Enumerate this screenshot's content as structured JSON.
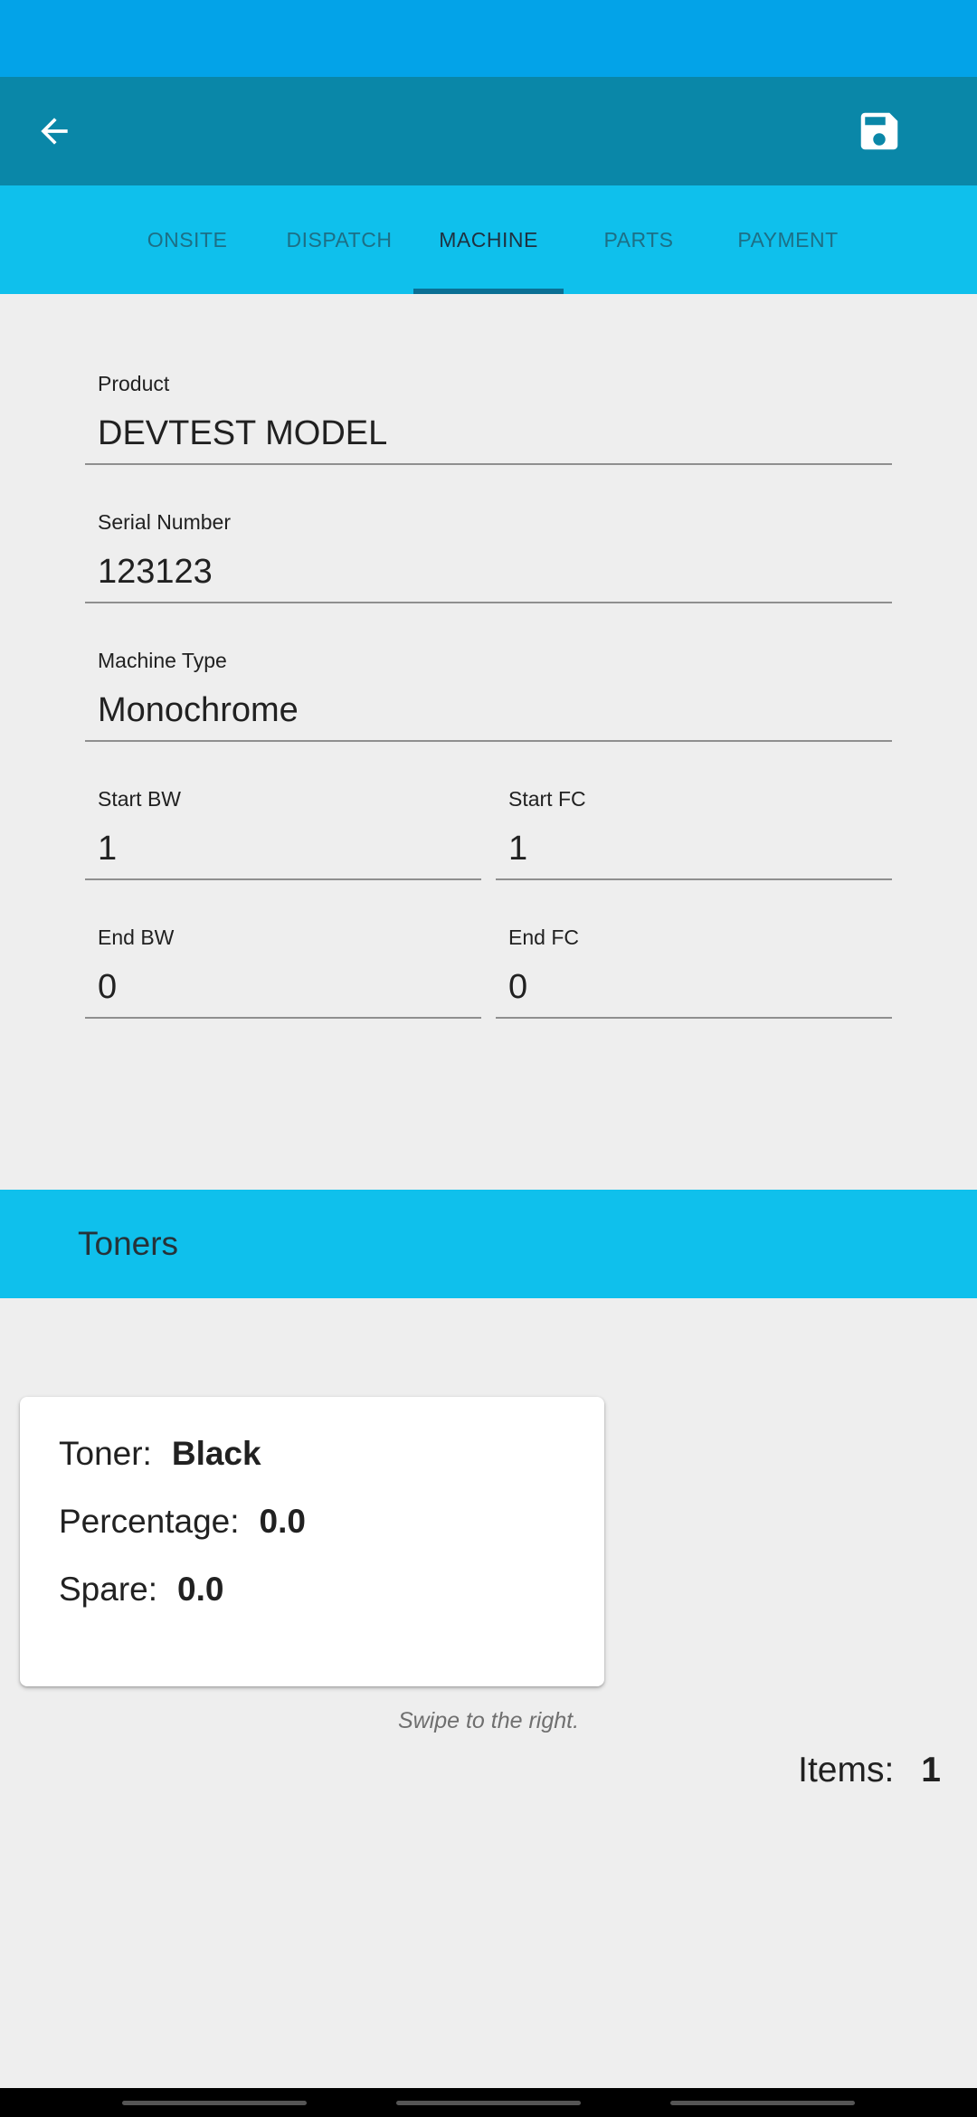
{
  "toolbar": {
    "back_icon": "arrow-back-icon",
    "save_icon": "floppy-disk-icon"
  },
  "tabs": [
    {
      "label": "ONSITE",
      "active": false
    },
    {
      "label": "DISPATCH",
      "active": false
    },
    {
      "label": "MACHINE",
      "active": true
    },
    {
      "label": "PARTS",
      "active": false
    },
    {
      "label": "PAYMENT",
      "active": false
    }
  ],
  "form": {
    "product": {
      "label": "Product",
      "value": "DEVTEST MODEL"
    },
    "serial_number": {
      "label": "Serial Number",
      "value": "123123"
    },
    "machine_type": {
      "label": "Machine Type",
      "value": "Monochrome"
    },
    "start_bw": {
      "label": "Start BW",
      "value": "1"
    },
    "start_fc": {
      "label": "Start FC",
      "value": "1"
    },
    "end_bw": {
      "label": "End BW",
      "value": "0"
    },
    "end_fc": {
      "label": "End FC",
      "value": "0"
    }
  },
  "toners": {
    "title": "Toners",
    "card": {
      "toner_label": "Toner:",
      "toner_value": "Black",
      "percentage_label": "Percentage:",
      "percentage_value": "0.0",
      "spare_label": "Spare:",
      "spare_value": "0.0"
    },
    "hint": "Swipe to the right.",
    "items_label": "Items:",
    "items_count": "1"
  },
  "colors": {
    "status_bar": "#03a3e8",
    "toolbar": "#0a87a8",
    "tabs_bg": "#0fc0ec",
    "tab_indicator": "#0a6f94",
    "background": "#eeeeee"
  }
}
